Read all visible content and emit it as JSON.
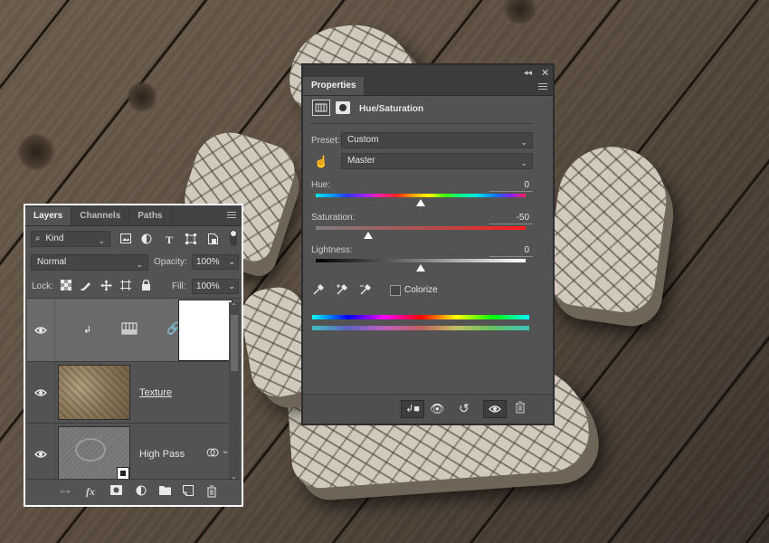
{
  "layers_panel": {
    "tabs": [
      {
        "label": "Layers",
        "active": true
      },
      {
        "label": "Channels",
        "active": false
      },
      {
        "label": "Paths",
        "active": false
      }
    ],
    "filter_kind": "Kind",
    "blend_mode": "Normal",
    "opacity_label": "Opacity:",
    "opacity_value": "100%",
    "lock_label": "Lock:",
    "fill_label": "Fill:",
    "fill_value": "100%",
    "layers": [
      {
        "name": "",
        "type": "adjustment",
        "selected": true
      },
      {
        "name": "Texture",
        "type": "image",
        "selected": false
      },
      {
        "name": "High Pass",
        "type": "smart-object",
        "selected": false
      }
    ]
  },
  "properties_panel": {
    "tab_label": "Properties",
    "adjustment_title": "Hue/Saturation",
    "preset_label": "Preset:",
    "preset_value": "Custom",
    "channel_value": "Master",
    "hue_label": "Hue:",
    "hue_value": "0",
    "saturation_label": "Saturation:",
    "saturation_value": "-50",
    "lightness_label": "Lightness:",
    "lightness_value": "0",
    "colorize_label": "Colorize",
    "colorize_checked": false,
    "hue_level": 0.5,
    "saturation_level": 0.25,
    "lightness_level": 0.5
  },
  "icons": {
    "search": "search-icon",
    "image_filter": "image-filter-icon",
    "adjustment_filter": "adjustment-filter-icon",
    "type_filter": "type-filter-icon",
    "shape_filter": "shape-filter-icon",
    "smart_filter": "smart-object-filter-icon",
    "link": "link-icon",
    "fx": "fx-icon",
    "mask": "mask-icon",
    "new_adjustment": "new-adjustment-icon",
    "folder": "folder-icon",
    "new_layer": "new-layer-icon",
    "trash": "trash-icon",
    "eye": "eye-icon"
  },
  "colors": {
    "panel_bg": "#535353",
    "tab_bar": "#424242",
    "selected_row": "#6a6a6a",
    "highlight_border": "#ffffff"
  }
}
